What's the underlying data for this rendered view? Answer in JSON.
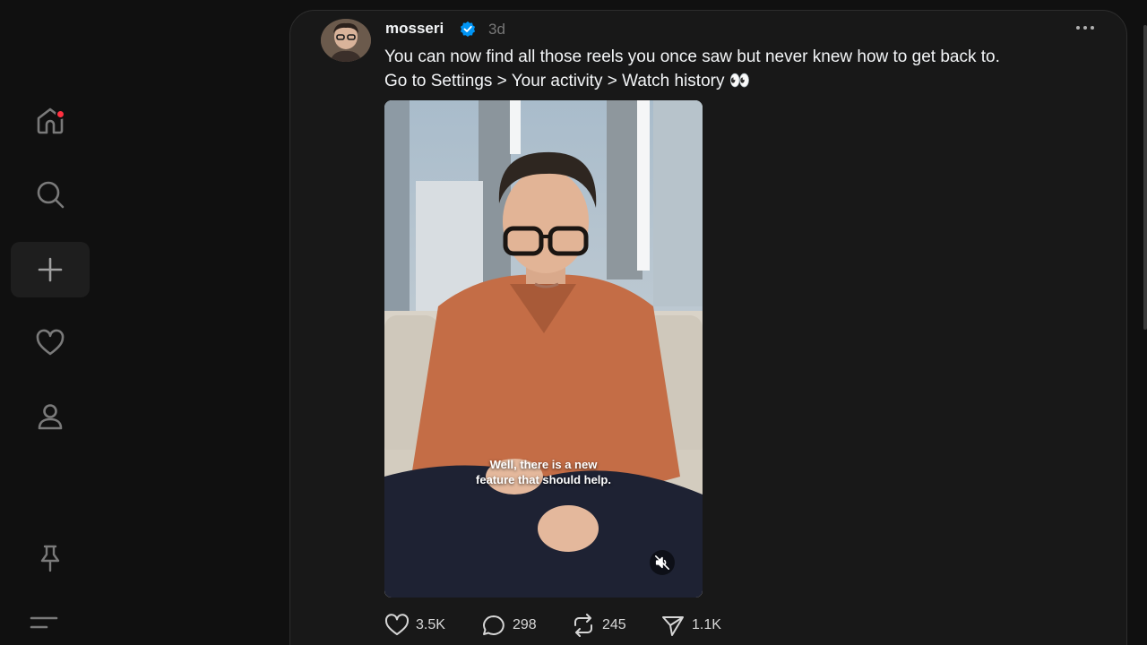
{
  "sidebar": {
    "items": [
      {
        "name": "home",
        "icon": "home-icon",
        "has_notification": true
      },
      {
        "name": "search",
        "icon": "search-icon"
      },
      {
        "name": "create",
        "icon": "plus-icon",
        "active": true
      },
      {
        "name": "activity",
        "icon": "heart-icon"
      },
      {
        "name": "profile",
        "icon": "person-icon"
      },
      {
        "name": "pin",
        "icon": "pin-icon"
      },
      {
        "name": "menu",
        "icon": "menu-icon"
      }
    ],
    "notification_color": "#ff3040"
  },
  "post": {
    "username": "mosseri",
    "verified": true,
    "verified_color": "#0095f6",
    "timestamp": "3d",
    "caption_line1": "You can now find all those reels you once saw but never knew how to get back to.",
    "caption_line2": "Go to Settings > Your activity > Watch history 👀",
    "video": {
      "subtitle_line1": "Well, there is a new",
      "subtitle_line2": "feature that should help.",
      "muted": true
    },
    "stats": {
      "likes": "3.5K",
      "replies": "298",
      "reposts": "245",
      "shares": "1.1K"
    }
  },
  "colors": {
    "background": "#101010",
    "card": "#181818",
    "text": "#f3f5f7",
    "muted_text": "#777777"
  }
}
